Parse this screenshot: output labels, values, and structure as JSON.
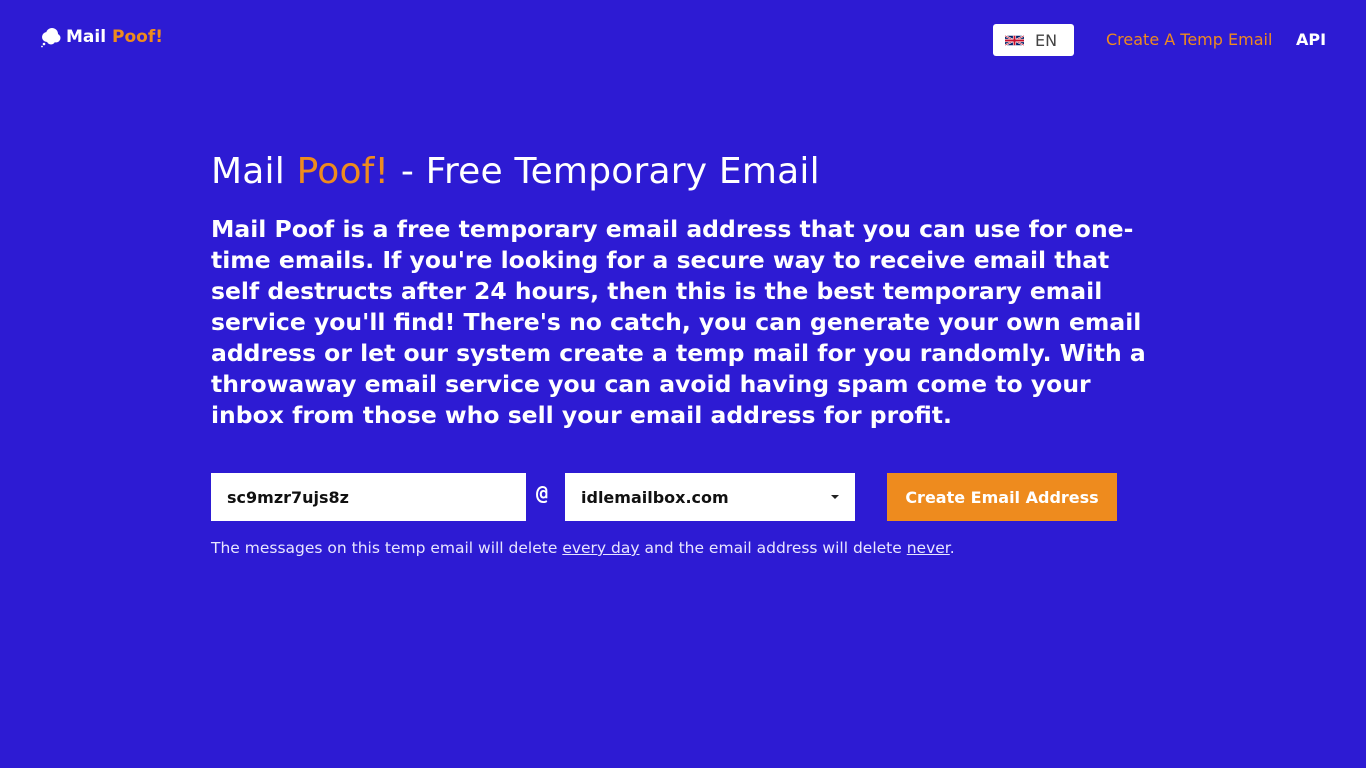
{
  "header": {
    "logo": {
      "icon": "cloud-icon",
      "mail": "Mail",
      "poof": "Poof!"
    },
    "language": {
      "flag": "uk-flag-icon",
      "code": "EN"
    },
    "nav": [
      {
        "label": "Create A Temp Email",
        "color": "#ee8b1e"
      },
      {
        "label": "API"
      }
    ]
  },
  "main": {
    "title": {
      "brand_a": "Mail",
      "brand_b": "Poof!",
      "rest": "- Free Temporary Email"
    },
    "description": "Mail Poof is a free temporary email address that you can use for one-time emails. If you're looking for a secure way to receive email that self destructs after 24 hours, then this is the best temporary email service you'll find! There's no catch, you can generate your own email address or let our system create a temp mail for you randomly. With a throwaway email service you can avoid having spam come to your inbox from those who sell your email address for profit."
  },
  "form": {
    "local_part": "sc9mzr7ujs8z",
    "at_symbol": "@",
    "domain": "idlemailbox.com",
    "create_button": "Create Email Address"
  },
  "note": {
    "prefix": "The messages on this temp email will delete",
    "link1": "every day",
    "middle": "and the email address will delete",
    "link2": "never",
    "suffix": "."
  },
  "colors": {
    "background": "#2d1bd3",
    "accent": "#ee8b1e",
    "text": "#ffffff"
  }
}
